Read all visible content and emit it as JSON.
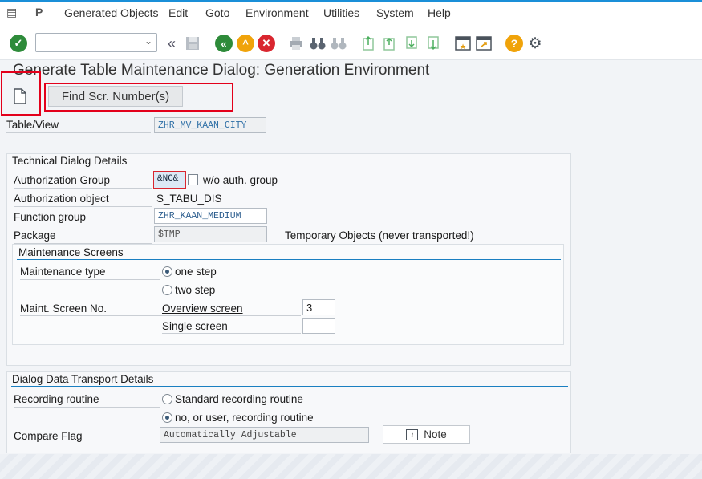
{
  "menu": {
    "items": [
      "Generated Objects",
      "Edit",
      "Goto",
      "Environment",
      "Utilities",
      "System",
      "Help"
    ]
  },
  "toolbar": {
    "icons": [
      "check-icon",
      "back-icon",
      "save-icon",
      "back-green-icon",
      "exit-icon",
      "cancel-icon",
      "print-icon",
      "find-icon",
      "find-next-icon",
      "first-page-icon",
      "previous-page-icon",
      "next-page-icon",
      "last-page-icon",
      "new-window-icon",
      "shortcut-icon",
      "help-icon",
      "settings-icon"
    ],
    "colors": {
      "green": "#2e8b3a",
      "orange": "#f0a30a",
      "red": "#d9262f"
    }
  },
  "page": {
    "title": "Generate Table Maintenance Dialog: Generation Environment"
  },
  "app_toolbar": {
    "find_button": "Find Scr. Number(s)"
  },
  "table_view": {
    "label": "Table/View",
    "value": "ZHR_MV_KAAN_CITY"
  },
  "technical": {
    "title": "Technical Dialog Details",
    "auth_group_label": "Authorization Group",
    "auth_group_value": "&NC&",
    "auth_group_text": "w/o auth. group",
    "auth_object_label": "Authorization object",
    "auth_object_value": "S_TABU_DIS",
    "function_group_label": "Function group",
    "function_group_value": "ZHR_KAAN_MEDIUM",
    "package_label": "Package",
    "package_value": "$TMP",
    "package_text": "Temporary Objects (never transported!)"
  },
  "maintenance": {
    "title": "Maintenance Screens",
    "type_label": "Maintenance type",
    "one_step": "one step",
    "two_step": "two step",
    "screen_no_label": "Maint. Screen No.",
    "overview_label": "Overview screen",
    "overview_value": "3",
    "single_label": "Single screen",
    "single_value": ""
  },
  "transport": {
    "title": "Dialog Data Transport Details",
    "recording_label": "Recording routine",
    "standard": "Standard recording routine",
    "no_user": "no, or user, recording routine",
    "compare_label": "Compare Flag",
    "compare_value": "Automatically Adjustable",
    "note_button": "Note"
  }
}
